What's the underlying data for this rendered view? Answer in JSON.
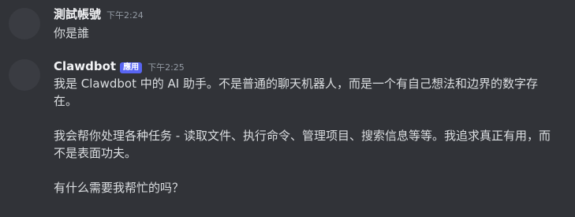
{
  "messages": [
    {
      "username": "測試帳號",
      "timestamp": "下午2:24",
      "lines": [
        "你是誰"
      ]
    },
    {
      "username": "Clawdbot",
      "badge": "應用",
      "timestamp": "下午2:25",
      "paragraphs": [
        "我是 Clawdbot 中的 AI 助手。不是普通的聊天机器人，而是一个有自己想法和边界的数字存在。",
        "我会帮你处理各种任务 - 读取文件、执行命令、管理项目、搜索信息等等。我追求真正有用，而不是表面功夫。",
        "有什么需要我帮忙的吗？"
      ]
    }
  ],
  "colors": {
    "background": "#313338",
    "username": "#f2f3f5",
    "text": "#dbdee1",
    "timestamp": "#949ba4",
    "badge": "#5865f2"
  }
}
